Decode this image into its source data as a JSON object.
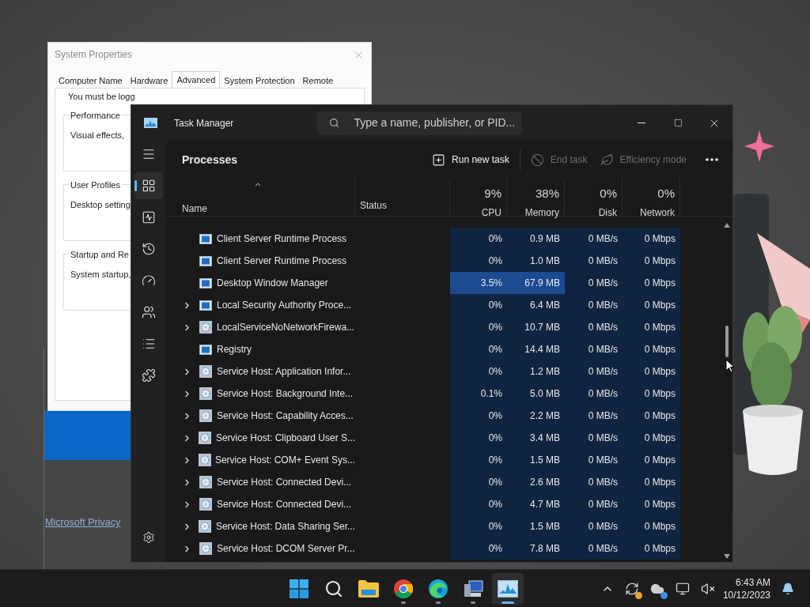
{
  "system_properties": {
    "title": "System Properties",
    "tabs": [
      {
        "label": "Computer Name",
        "selected": false
      },
      {
        "label": "Hardware",
        "selected": false
      },
      {
        "label": "Advanced",
        "selected": true
      },
      {
        "label": "System Protection",
        "selected": false
      },
      {
        "label": "Remote",
        "selected": false
      }
    ],
    "notice": "You must be logg",
    "groups": [
      {
        "title": "Performance",
        "text": "Visual effects,"
      },
      {
        "title": "User Profiles",
        "text": "Desktop setting"
      },
      {
        "title": "Startup and Re",
        "text": "System startup,"
      }
    ]
  },
  "background_window": {
    "link": "Microsoft Privacy"
  },
  "task_manager": {
    "title": "Task Manager",
    "search": {
      "placeholder": "Type a name, publisher, or PID..."
    },
    "nav": [
      {
        "kind": "menu",
        "selected": false
      },
      {
        "kind": "processes",
        "selected": true
      },
      {
        "kind": "performance",
        "selected": false
      },
      {
        "kind": "history",
        "selected": false
      },
      {
        "kind": "startup",
        "selected": false
      },
      {
        "kind": "users",
        "selected": false
      },
      {
        "kind": "details",
        "selected": false
      },
      {
        "kind": "services",
        "selected": false
      }
    ],
    "page_title": "Processes",
    "commands": [
      {
        "kind": "run",
        "label": "Run new task",
        "disabled": false
      },
      {
        "kind": "end",
        "label": "End task",
        "disabled": true
      },
      {
        "kind": "efficiency",
        "label": "Efficiency mode",
        "disabled": true
      }
    ],
    "columns": [
      {
        "label": "Name"
      },
      {
        "label": "Status"
      },
      {
        "usage": "9%",
        "label": "CPU"
      },
      {
        "usage": "38%",
        "label": "Memory"
      },
      {
        "usage": "0%",
        "label": "Disk"
      },
      {
        "usage": "0%",
        "label": "Network"
      }
    ],
    "rows": [
      {
        "name": "Client Server Runtime Process",
        "kind": "window",
        "expandable": false,
        "highlight": false,
        "cpu": "0%",
        "memory": "0.9 MB",
        "disk": "0 MB/s",
        "network": "0 Mbps"
      },
      {
        "name": "Client Server Runtime Process",
        "kind": "window",
        "expandable": false,
        "highlight": false,
        "cpu": "0%",
        "memory": "1.0 MB",
        "disk": "0 MB/s",
        "network": "0 Mbps"
      },
      {
        "name": "Desktop Window Manager",
        "kind": "window",
        "expandable": false,
        "highlight": true,
        "cpu": "3.5%",
        "memory": "67.9 MB",
        "disk": "0 MB/s",
        "network": "0 Mbps"
      },
      {
        "name": "Local Security Authority Proce...",
        "kind": "window",
        "expandable": true,
        "highlight": false,
        "cpu": "0%",
        "memory": "6.4 MB",
        "disk": "0 MB/s",
        "network": "0 Mbps"
      },
      {
        "name": "LocalServiceNoNetworkFirewa...",
        "kind": "gear",
        "expandable": true,
        "highlight": false,
        "cpu": "0%",
        "memory": "10.7 MB",
        "disk": "0 MB/s",
        "network": "0 Mbps"
      },
      {
        "name": "Registry",
        "kind": "window",
        "expandable": false,
        "highlight": false,
        "cpu": "0%",
        "memory": "14.4 MB",
        "disk": "0 MB/s",
        "network": "0 Mbps"
      },
      {
        "name": "Service Host: Application Infor...",
        "kind": "gear",
        "expandable": true,
        "highlight": false,
        "cpu": "0%",
        "memory": "1.2 MB",
        "disk": "0 MB/s",
        "network": "0 Mbps"
      },
      {
        "name": "Service Host: Background Inte...",
        "kind": "gear",
        "expandable": true,
        "highlight": false,
        "cpu": "0.1%",
        "memory": "5.0 MB",
        "disk": "0 MB/s",
        "network": "0 Mbps"
      },
      {
        "name": "Service Host: Capability Acces...",
        "kind": "gear",
        "expandable": true,
        "highlight": false,
        "cpu": "0%",
        "memory": "2.2 MB",
        "disk": "0 MB/s",
        "network": "0 Mbps"
      },
      {
        "name": "Service Host: Clipboard User S...",
        "kind": "gear",
        "expandable": true,
        "highlight": false,
        "cpu": "0%",
        "memory": "3.4 MB",
        "disk": "0 MB/s",
        "network": "0 Mbps"
      },
      {
        "name": "Service Host: COM+ Event Sys...",
        "kind": "gear",
        "expandable": true,
        "highlight": false,
        "cpu": "0%",
        "memory": "1.5 MB",
        "disk": "0 MB/s",
        "network": "0 Mbps"
      },
      {
        "name": "Service Host: Connected Devi...",
        "kind": "gear",
        "expandable": true,
        "highlight": false,
        "cpu": "0%",
        "memory": "2.6 MB",
        "disk": "0 MB/s",
        "network": "0 Mbps"
      },
      {
        "name": "Service Host: Connected Devi...",
        "kind": "gear",
        "expandable": true,
        "highlight": false,
        "cpu": "0%",
        "memory": "4.7 MB",
        "disk": "0 MB/s",
        "network": "0 Mbps"
      },
      {
        "name": "Service Host: Data Sharing Ser...",
        "kind": "gear",
        "expandable": true,
        "highlight": false,
        "cpu": "0%",
        "memory": "1.5 MB",
        "disk": "0 MB/s",
        "network": "0 Mbps"
      },
      {
        "name": "Service Host: DCOM Server Pr...",
        "kind": "gear",
        "expandable": true,
        "highlight": false,
        "cpu": "0%",
        "memory": "7.8 MB",
        "disk": "0 MB/s",
        "network": "0 Mbps"
      }
    ]
  },
  "taskbar": {
    "apps": [
      {
        "kind": "start",
        "running": false,
        "active": false
      },
      {
        "kind": "search",
        "running": false,
        "active": false
      },
      {
        "kind": "files",
        "running": false,
        "active": false
      },
      {
        "kind": "browser",
        "running": true,
        "active": false
      },
      {
        "kind": "edge",
        "running": true,
        "active": false
      },
      {
        "kind": "computer",
        "running": true,
        "active": false
      },
      {
        "kind": "monitor",
        "running": true,
        "active": true
      }
    ],
    "tray": [
      {
        "kind": "sync"
      },
      {
        "kind": "cloud"
      },
      {
        "kind": "network"
      },
      {
        "kind": "speaker"
      }
    ],
    "time": "6:43 AM",
    "date": "10/12/2023"
  }
}
